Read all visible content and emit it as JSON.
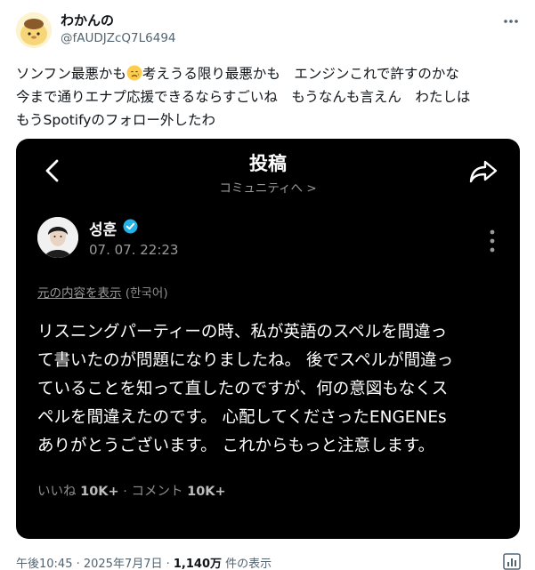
{
  "tweet": {
    "author_name": "わかんの",
    "author_handle": "@fAUDJZcQ7L6494",
    "text_lines": {
      "l1a": "ソンフン最悪かも",
      "l1b": "考えうる限り最悪かも　エンジンこれで許すのかな",
      "l2": "今まで通りエナプ応援できるならすごいね　もうなんも言えん　わたしは",
      "l3": "もうSpotifyのフォロー外したわ"
    },
    "emoji_icon": "sad-face-with-tear-emoji",
    "posted_at": "午後10:45 · 2025年7月7日 · ",
    "view_count": "1,140万",
    "view_suffix": " 件の表示"
  },
  "embedded_post": {
    "header_title": "投稿",
    "community_link": "コミュニティへ >",
    "author_name": "성훈",
    "post_date": "07. 07. 22:23",
    "show_original": "元の内容を表示",
    "original_language": " (한국어)",
    "body_lines": {
      "l1": "リスニングパーティーの時、私が英語のスペルを間違っ",
      "l2": "て書いたのが問題になりましたね。 後でスペルが間違っ",
      "l3": "ていることを知って直したのですが、何の意図もなくス",
      "l4": "ペルを間違えたのです。 心配してくださったENGENEs",
      "l5": "ありがとうございます。 これからもっと注意します。"
    },
    "likes_label": "いいね ",
    "likes_count": "10K+",
    "separator": " · ",
    "comments_label": "コメント ",
    "comments_count": "10K+"
  },
  "colors": {
    "text_primary": "#0f1419",
    "text_secondary": "#536471",
    "embed_background": "#000000",
    "verified_badge": "#24b3e8"
  }
}
